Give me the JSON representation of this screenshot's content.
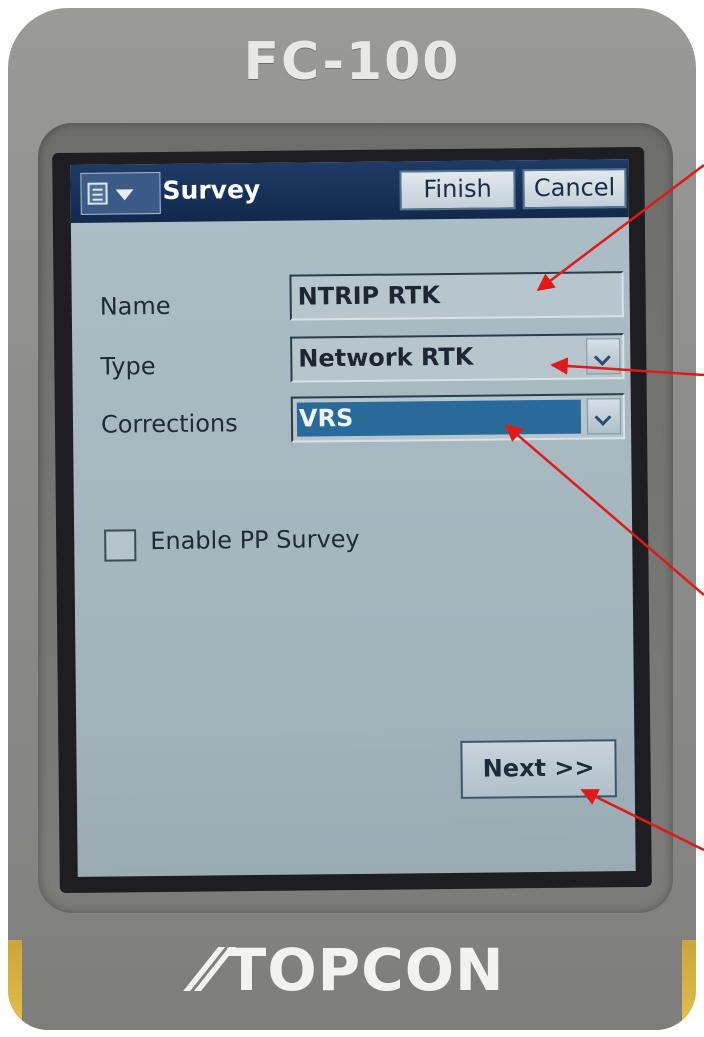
{
  "device": {
    "model": "FC-100",
    "brand": "TOPCON"
  },
  "window": {
    "title": "Survey",
    "finish_label": "Finish",
    "cancel_label": "Cancel",
    "start_icon": "start-menu-icon"
  },
  "form": {
    "name_label": "Name",
    "name_value": "NTRIP RTK",
    "type_label": "Type",
    "type_value": "Network RTK",
    "corrections_label": "Corrections",
    "corrections_value": "VRS",
    "enable_pp_label": "Enable PP Survey",
    "enable_pp_checked": false,
    "next_label": "Next >>"
  },
  "colors": {
    "title_bar": "#12294c",
    "selection": "#2a6a9a",
    "annotation_arrow": "#e11919"
  }
}
